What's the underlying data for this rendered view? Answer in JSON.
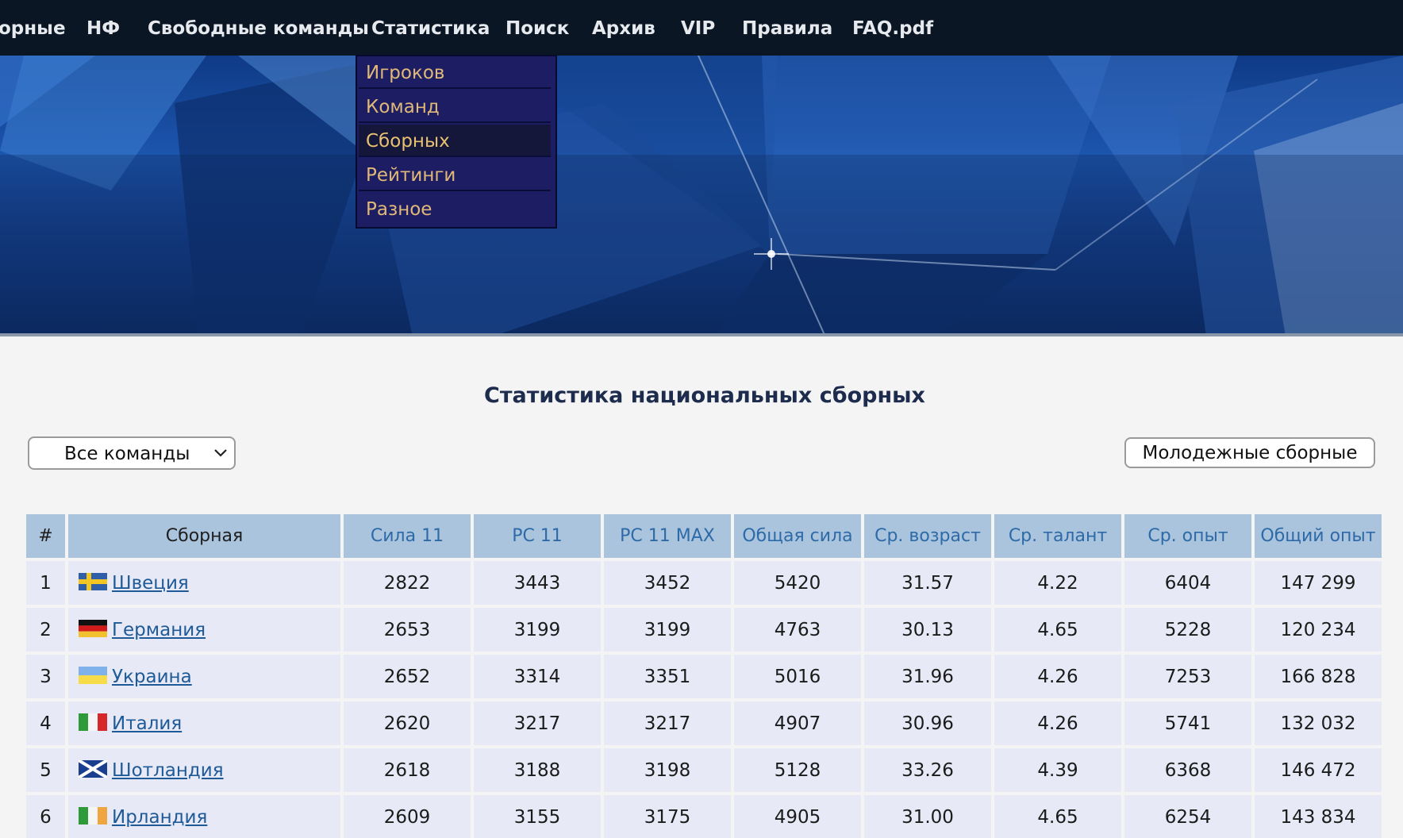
{
  "nav": {
    "items": [
      "орные",
      "НФ",
      "Свободные команды",
      "Статистика",
      "Поиск",
      "Архив",
      "VIP",
      "Правила",
      "FAQ.pdf"
    ]
  },
  "stats_menu": {
    "items": [
      "Игроков",
      "Команд",
      "Сборных",
      "Рейтинги",
      "Разное"
    ],
    "active": "Сборных"
  },
  "page": {
    "title": "Статистика национальных сборных"
  },
  "filter": {
    "selected": "Все команды"
  },
  "youth_button": "Молодежные сборные",
  "table": {
    "headers": [
      "#",
      "Сборная",
      "Сила 11",
      "РС 11",
      "РС 11 MAX",
      "Общая сила",
      "Ср. возраст",
      "Ср. талант",
      "Ср. опыт",
      "Общий опыт"
    ],
    "rows": [
      {
        "rank": "1",
        "team": "Швеция",
        "flag": "sweden-flag-icon",
        "values": [
          "2822",
          "3443",
          "3452",
          "5420",
          "31.57",
          "4.22",
          "6404",
          "147 299"
        ]
      },
      {
        "rank": "2",
        "team": "Германия",
        "flag": "germany-flag-icon",
        "values": [
          "2653",
          "3199",
          "3199",
          "4763",
          "30.13",
          "4.65",
          "5228",
          "120 234"
        ]
      },
      {
        "rank": "3",
        "team": "Украина",
        "flag": "ukraine-flag-icon",
        "values": [
          "2652",
          "3314",
          "3351",
          "5016",
          "31.96",
          "4.26",
          "7253",
          "166 828"
        ]
      },
      {
        "rank": "4",
        "team": "Италия",
        "flag": "italy-flag-icon",
        "values": [
          "2620",
          "3217",
          "3217",
          "4907",
          "30.96",
          "4.26",
          "5741",
          "132 032"
        ]
      },
      {
        "rank": "5",
        "team": "Шотландия",
        "flag": "scotland-flag-icon",
        "values": [
          "2618",
          "3188",
          "3198",
          "5128",
          "33.26",
          "4.39",
          "6368",
          "146 472"
        ]
      },
      {
        "rank": "6",
        "team": "Ирландия",
        "flag": "ireland-flag-icon",
        "values": [
          "2609",
          "3155",
          "3175",
          "4905",
          "31.00",
          "4.65",
          "6254",
          "143 834"
        ]
      }
    ]
  },
  "colors": {
    "nav_bg": "#0b1624",
    "dropdown_bg": "#1c1d63",
    "dropdown_text": "#e0b878",
    "header_bg": "#a9c4dc",
    "header_text": "#2f6aa8",
    "row_bg": "#e7eaf6",
    "link": "#1f5a98"
  }
}
